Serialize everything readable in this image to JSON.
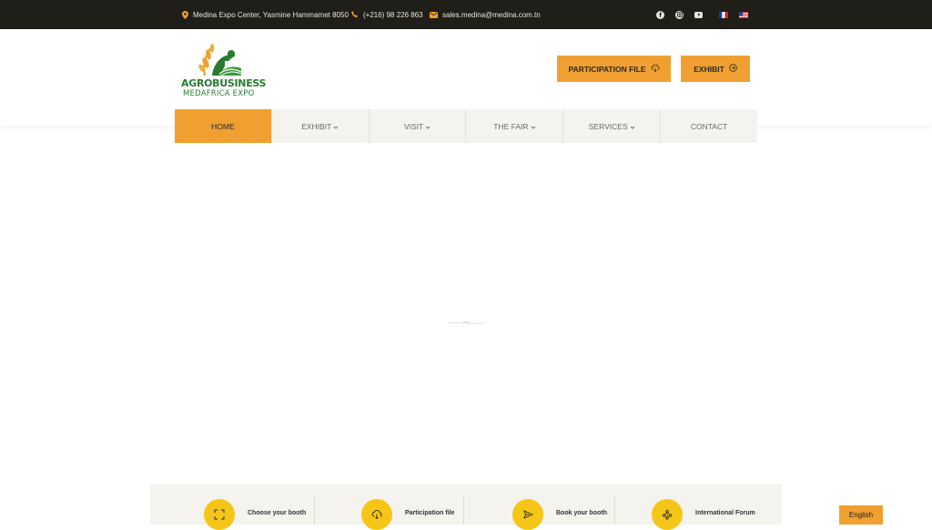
{
  "topbar": {
    "address": "Medina Expo Center, Yasmine Hammamet 8050",
    "phone": "(+216) 98 226 863",
    "email": "sales.medina@medina.com.tn",
    "socials": [
      "facebook-icon",
      "instagram-icon",
      "youtube-icon"
    ],
    "languages": [
      "French",
      "English"
    ]
  },
  "logo": {
    "line1_a": "AGRO",
    "line1_b": "BUSINESS",
    "line2": "MEDAFRICA EXPO"
  },
  "header_buttons": {
    "participation": "PARTICIPATION FILE",
    "exhibit": "EXHIBIT"
  },
  "nav": {
    "items": [
      {
        "label": "HOME",
        "active": true
      },
      {
        "label": "EXHIBIT",
        "dropdown": true
      },
      {
        "label": "VISIT",
        "dropdown": true
      },
      {
        "label": "THE FAIR",
        "dropdown": true
      },
      {
        "label": "SERVICES",
        "dropdown": true
      },
      {
        "label": "CONTACT"
      }
    ]
  },
  "features": [
    {
      "label": "Choose your booth",
      "icon": "expand-icon"
    },
    {
      "label": "Participation file",
      "icon": "cloud-download-icon"
    },
    {
      "label": "Book your booth",
      "icon": "send-icon"
    },
    {
      "label": "International Forum",
      "icon": "network-icon"
    }
  ],
  "language_switcher": "English",
  "colors": {
    "accent": "#f0a030",
    "dark": "#1f1e18",
    "nav_bg": "#f5f3ee",
    "feature_circle": "#f5c518",
    "brand_green": "#2a7a30"
  }
}
